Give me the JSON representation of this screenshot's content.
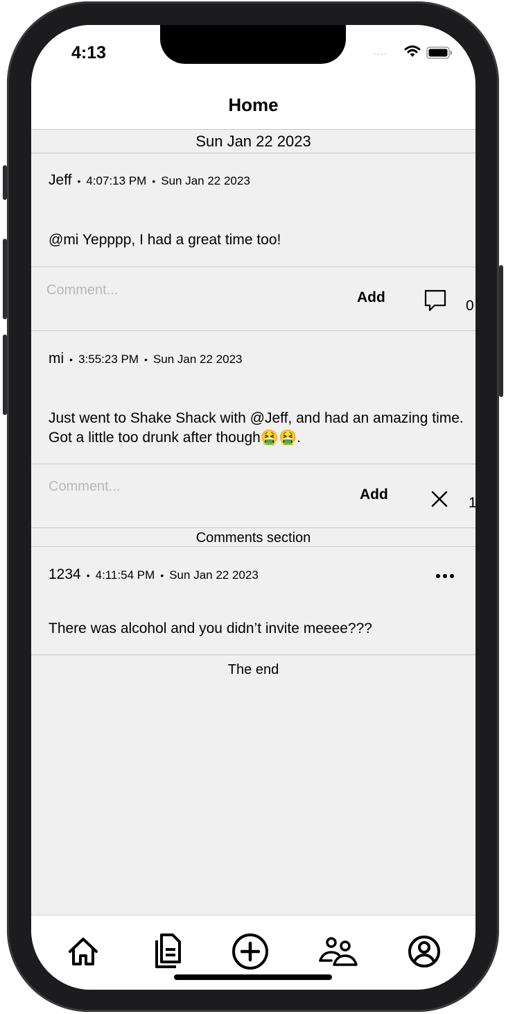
{
  "status_bar": {
    "time": "4:13",
    "signal": "....",
    "wifi_icon": "wifi-icon",
    "battery_icon": "battery-icon"
  },
  "header": {
    "title": "Home"
  },
  "feed": {
    "date_header": "Sun Jan 22 2023",
    "posts": [
      {
        "author": "Jeff",
        "time": "4:07:13 PM",
        "date": "Sun Jan 22 2023",
        "body": "@mi Yepppp, I had a great time too!",
        "comment_placeholder": "Comment...",
        "add_label": "Add",
        "comment_icon": "comment-bubble-icon",
        "comment_count": "0"
      },
      {
        "author": "mi",
        "time": "3:55:23 PM",
        "date": "Sun Jan 22 2023",
        "body": "Just went to Shake Shack with @Jeff, and had an amazing time. Got a little too drunk after though🤮🤮.",
        "comment_placeholder": "Comment...",
        "add_label": "Add",
        "close_icon": "close-icon",
        "comment_count": "1"
      }
    ],
    "comments_section_label": "Comments section",
    "comments": [
      {
        "author": "1234",
        "time": "4:11:54 PM",
        "date": "Sun Jan 22 2023",
        "body": "There was alcohol and you didn’t invite meeee???",
        "more_icon": "more-icon"
      }
    ],
    "end_label": "The end"
  },
  "tab_bar": {
    "tabs": [
      {
        "icon": "home-icon"
      },
      {
        "icon": "documents-icon"
      },
      {
        "icon": "add-circle-icon"
      },
      {
        "icon": "people-icon"
      },
      {
        "icon": "profile-icon"
      }
    ]
  }
}
